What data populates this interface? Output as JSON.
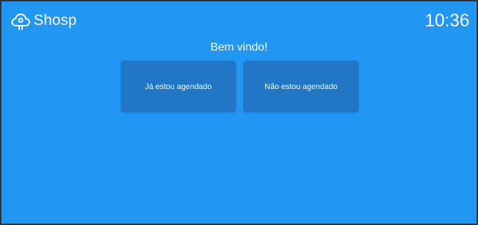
{
  "header": {
    "logo_icon": "cloud-logo-icon",
    "logo_text": "Shosp",
    "time": "10:36"
  },
  "main": {
    "welcome": "Bem vindo!",
    "buttons": [
      {
        "label": "Já estou agendado"
      },
      {
        "label": "Não estou agendado"
      }
    ]
  },
  "colors": {
    "background": "#2196f3",
    "button": "#2176c6",
    "text": "#ffffff",
    "frame": "#2f3136"
  }
}
